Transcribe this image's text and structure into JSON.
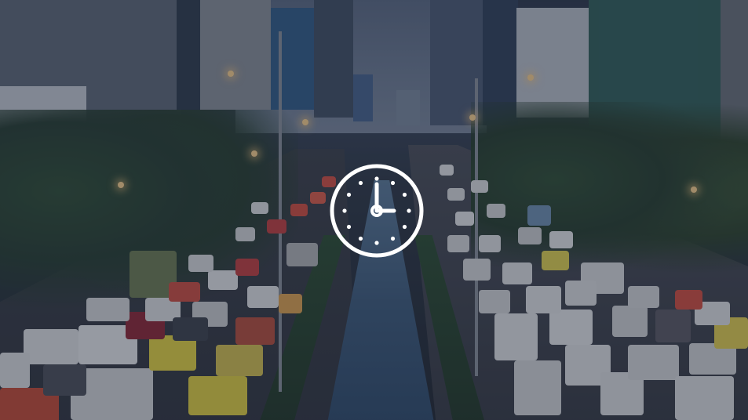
{
  "image": {
    "subject": "traffic-jam-city-street",
    "icon": "clock-icon",
    "overlay_color": "#1e283c",
    "icon_color": "#ffffff"
  }
}
